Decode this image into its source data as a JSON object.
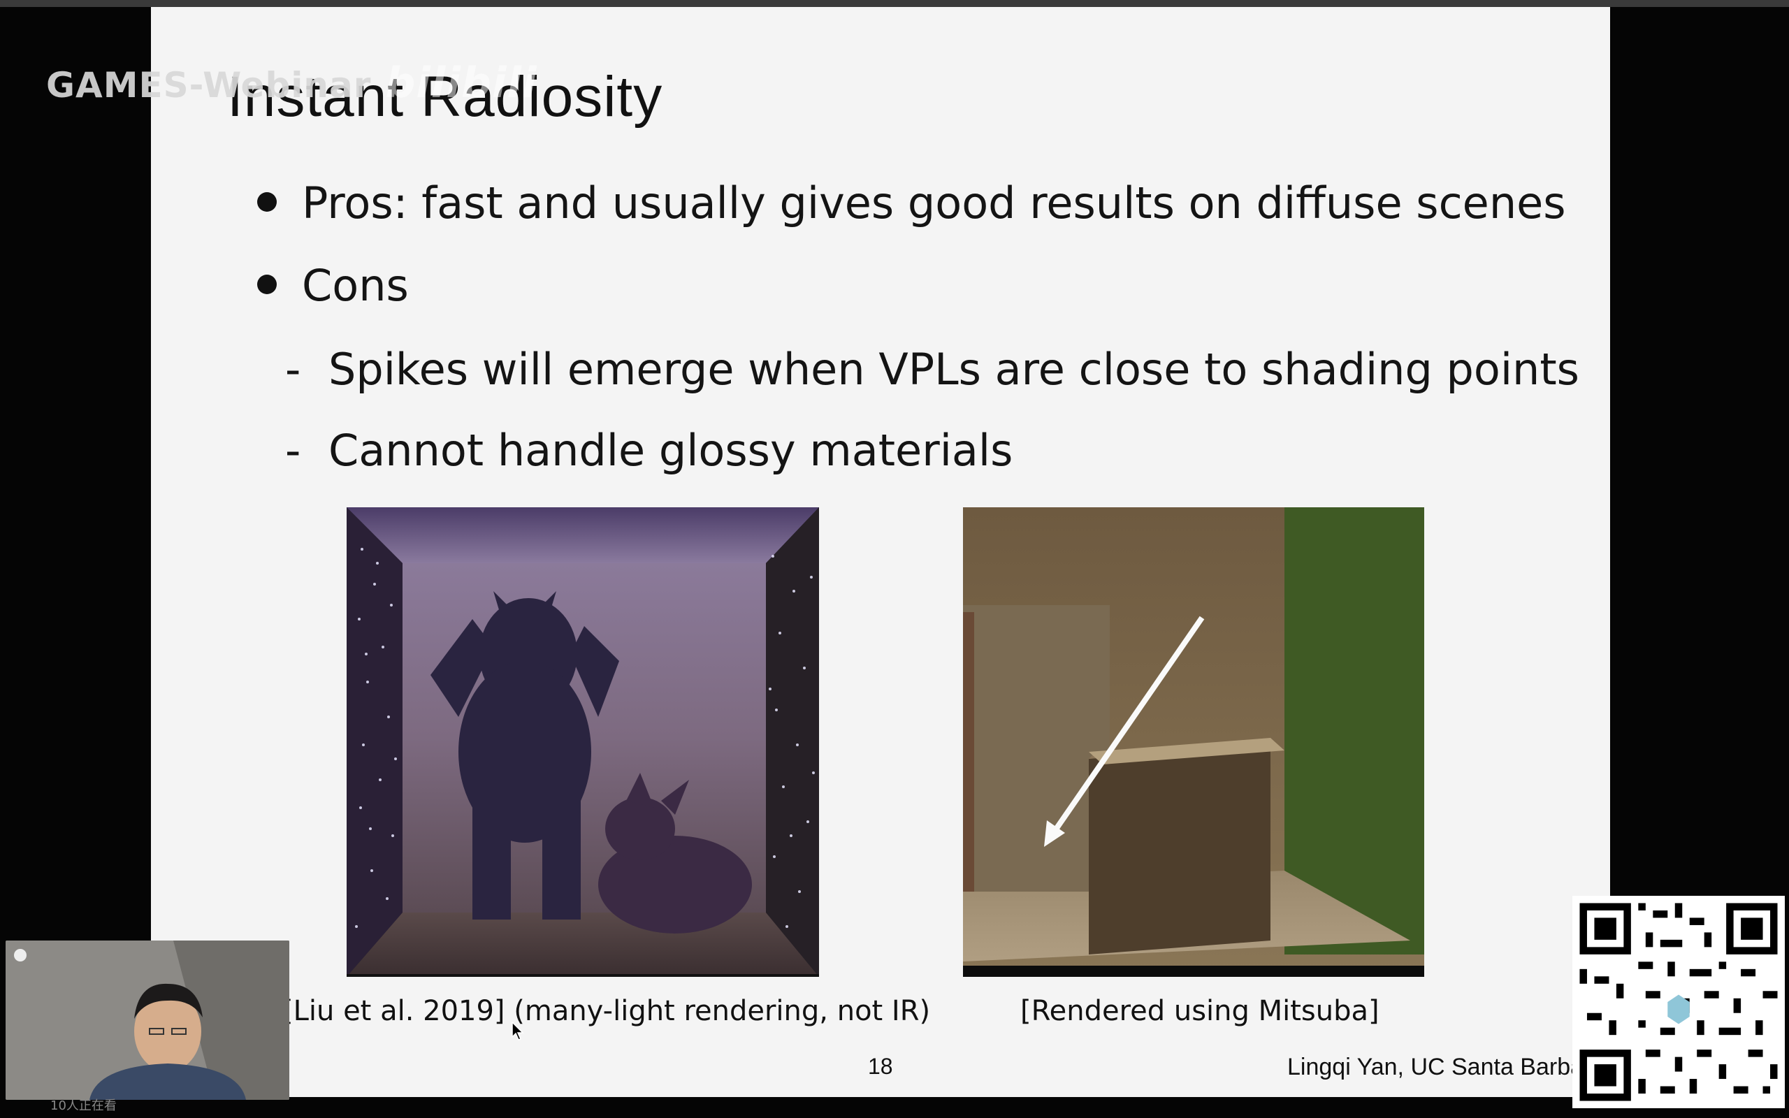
{
  "overlay": {
    "channel_watermark": "GAMES-Webinar",
    "platform_logo": "bilibili",
    "viewers_text": "10人正在看"
  },
  "slide": {
    "title": "Instant Radiosity",
    "bullets": [
      {
        "type": "bullet",
        "text": "Pros: fast and usually gives good results on diffuse scenes"
      },
      {
        "type": "bullet",
        "text": "Cons"
      },
      {
        "type": "sub",
        "text": "Spikes will emerge when VPLs are close to shading points"
      },
      {
        "type": "sub",
        "text": "Cannot handle glossy materials"
      }
    ],
    "figure_left_caption": "[Liu et al. 2019] (many-light rendering, not IR)",
    "figure_right_caption": "[Rendered using Mitsuba]",
    "page_number": "18",
    "author": "Lingqi Yan, UC Santa Barbara"
  },
  "icons": {
    "recording": "record-dot-icon",
    "qr": "qr-code-icon",
    "cursor": "mouse-cursor-icon"
  },
  "colors": {
    "slide_bg": "#f4f4f4",
    "screen_bg": "#050505",
    "text": "#111111"
  }
}
